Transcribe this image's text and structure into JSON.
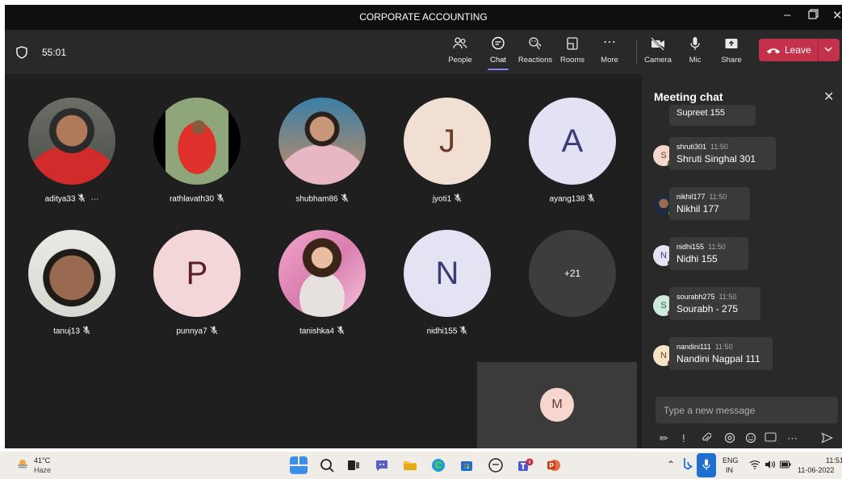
{
  "window": {
    "title": "CORPORATE ACCOUNTING"
  },
  "toolbar": {
    "timer": "55:01",
    "buttons": [
      {
        "label": "People",
        "icon": "people-icon"
      },
      {
        "label": "Chat",
        "icon": "chat-icon",
        "active": true
      },
      {
        "label": "Reactions",
        "icon": "reactions-icon"
      },
      {
        "label": "Rooms",
        "icon": "rooms-icon"
      },
      {
        "label": "More",
        "icon": "more-icon"
      },
      {
        "label": "Camera",
        "icon": "camera-off-icon"
      },
      {
        "label": "Mic",
        "icon": "mic-icon"
      },
      {
        "label": "Share",
        "icon": "share-icon"
      }
    ],
    "leave_label": "Leave"
  },
  "participants": [
    {
      "name": "aditya33",
      "avatar": "photo"
    },
    {
      "name": "rathlavath30",
      "avatar": "photo"
    },
    {
      "name": "shubham86",
      "avatar": "photo"
    },
    {
      "name": "jyoti1",
      "avatar": "J"
    },
    {
      "name": "ayang138",
      "avatar": "A"
    },
    {
      "name": "tanuj13",
      "avatar": "photo"
    },
    {
      "name": "punnya7",
      "avatar": "P"
    },
    {
      "name": "tanishka4",
      "avatar": "photo"
    },
    {
      "name": "nidhi155",
      "avatar": "N"
    },
    {
      "name": "",
      "avatar": "+21"
    }
  ],
  "self_view": {
    "initial": "M"
  },
  "chat": {
    "header": "Meeting chat",
    "partial_message": "Supreet 155",
    "messages": [
      {
        "initial": "S",
        "sender": "shruti301",
        "time": "11:50",
        "text": "Shruti Singhal 301",
        "status_color": "#6bb700"
      },
      {
        "initial": "",
        "sender": "nikhil177",
        "time": "11:50",
        "text": "Nikhil 177",
        "status_color": "#6bb700"
      },
      {
        "initial": "N",
        "sender": "nidhi155",
        "time": "11:50",
        "text": "Nidhi 155",
        "status_color": "#c4314b"
      },
      {
        "initial": "S",
        "sender": "sourabh275",
        "time": "11:50",
        "text": "Sourabh - 275",
        "status_color": "#c4314b"
      },
      {
        "initial": "N",
        "sender": "nandini111",
        "time": "11:50",
        "text": "Nandini Nagpal 111",
        "status_color": "#c4314b"
      }
    ],
    "compose_placeholder": "Type a new message"
  },
  "taskbar": {
    "weather_temp": "41°C",
    "weather_cond": "Haze",
    "lang_line1": "ENG",
    "lang_line2": "IN",
    "clock_time": "11:51",
    "clock_date": "11-06-2022"
  },
  "colors": {
    "accent": "#7f85f5",
    "leave": "#c4314b",
    "panel": "#292929",
    "stage": "#1f1f1f"
  }
}
